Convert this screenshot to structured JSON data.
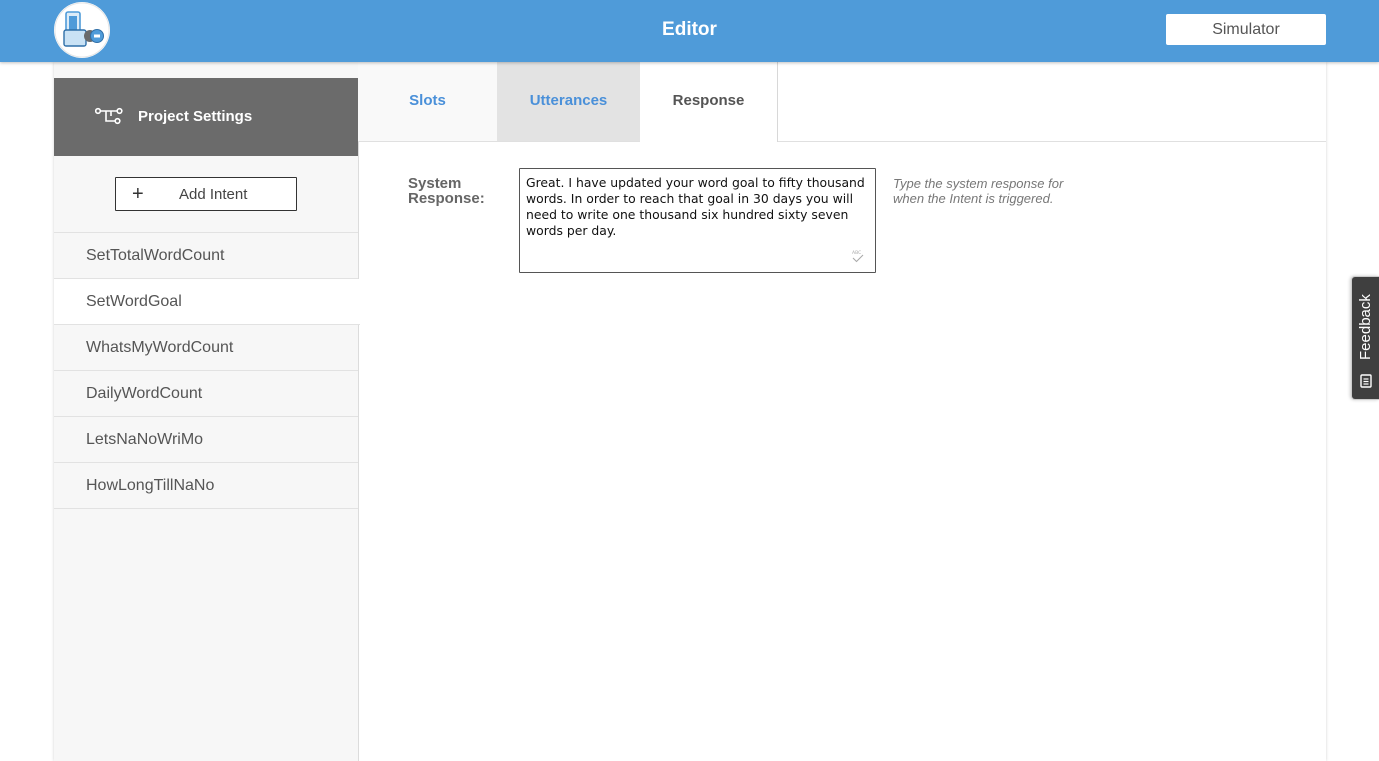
{
  "header": {
    "title": "Editor",
    "simulator_label": "Simulator",
    "accent_color": "#4f9bd9"
  },
  "sidebar": {
    "project_settings_label": "Project Settings",
    "add_intent_label": "Add Intent",
    "intents": [
      {
        "label": "SetTotalWordCount",
        "active": false
      },
      {
        "label": "SetWordGoal",
        "active": true
      },
      {
        "label": "WhatsMyWordCount",
        "active": false
      },
      {
        "label": "DailyWordCount",
        "active": false
      },
      {
        "label": "LetsNaNoWriMo",
        "active": false
      },
      {
        "label": "HowLongTillNaNo",
        "active": false
      }
    ]
  },
  "tabs": [
    {
      "label": "Slots",
      "selected": false
    },
    {
      "label": "Utterances",
      "selected": false
    },
    {
      "label": "Response",
      "selected": true
    }
  ],
  "response": {
    "label": "System Response:",
    "value": "Great. I have updated your word goal to fifty thousand words. In order to reach that goal in 30 days you will need to write one thousand six hundred sixty seven words per day.",
    "hint": "Type the system response for when the Intent is triggered."
  },
  "feedback": {
    "label": "Feedback"
  }
}
